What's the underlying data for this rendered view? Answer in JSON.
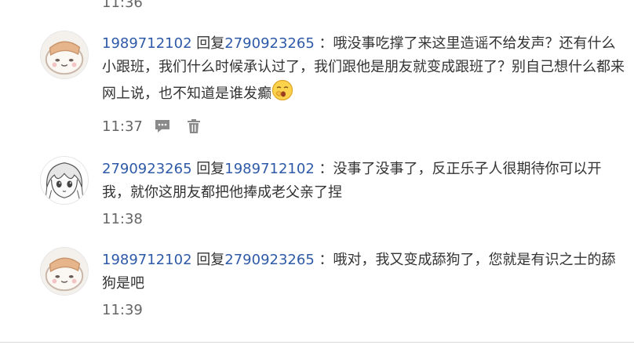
{
  "previous_time": "11:36",
  "replies": [
    {
      "user": "1989712102",
      "reply_word": "回复",
      "target": "2790923265",
      "separator": "：",
      "text": "哦没事吃撑了来这里造谣不给发声？还有什么小跟班，我们什么时候承认过了，我们跟他是朋友就变成跟班了？别自己想什么都来网上说，也不知道是谁发癫",
      "time": "11:37",
      "avatar_icon": "cartoon-cat-avatar",
      "emoji_icon": "yawn-emoji",
      "actions": [
        "reply-icon",
        "delete-icon"
      ]
    },
    {
      "user": "2790923265",
      "reply_word": "回复",
      "target": "1989712102",
      "separator": "：",
      "text": "没事了没事了，反正乐子人很期待你可以开我，就你这朋友都把他捧成老父亲了捏",
      "time": "11:38",
      "avatar_icon": "anime-girl-avatar"
    },
    {
      "user": "1989712102",
      "reply_word": "回复",
      "target": "2790923265",
      "separator": "：",
      "text": "哦对，我又变成舔狗了，您就是有识之士的舔狗是吧",
      "time": "11:39",
      "avatar_icon": "cartoon-cat-avatar"
    }
  ],
  "colors": {
    "username": "#2e5aa8",
    "text": "#333333",
    "time": "#666666",
    "icon": "#8a8a8a"
  }
}
